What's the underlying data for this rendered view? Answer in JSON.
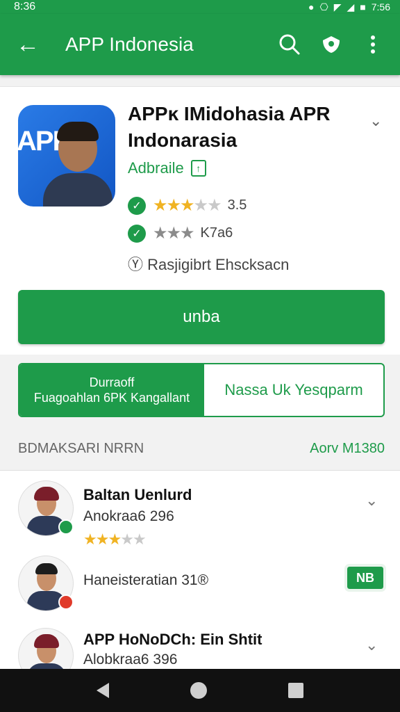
{
  "status_bar": {
    "time": "8:36",
    "clock_right": "7:56",
    "icons": [
      "notification-icon",
      "vibrate-icon",
      "wifi-icon",
      "signal-icon",
      "battery-icon"
    ]
  },
  "app_bar": {
    "title": "APP Indonesia",
    "icons": [
      "back-arrow-icon",
      "search-icon",
      "shield-icon",
      "more-vert-icon"
    ]
  },
  "app_detail": {
    "title": "APPĸ IMidohasia APR Indonarasia",
    "subtitle": "Adbraile",
    "rating_1": "3.5",
    "rating_1_stars": 3.5,
    "rating_2": "K7a6",
    "meta": "Rasjigibrt Ehscksacn",
    "install_label": "unba"
  },
  "tabs": {
    "active_line1": "Durraoff",
    "active_line2": "Fuagoahlan 6PK Kangallant",
    "inactive": "Nassa Uk Yesqparm"
  },
  "section": {
    "label": "BDMAKSARI NRRN",
    "right": "Aorv M1380"
  },
  "list": [
    {
      "title": "Baltan Uenlurd",
      "subtitle": "Anokraa6 296",
      "stars": 3.5,
      "action": "chevron",
      "badge": "green"
    },
    {
      "title": "",
      "subtitle": "Haneisteratian 31®",
      "action": "NB",
      "badge": "red"
    },
    {
      "title": "APP HoNoDCh: Ein Shtit",
      "subtitle": "Alobkraa6 396",
      "action": "chevron",
      "badge": "green"
    }
  ],
  "colors": {
    "brand_green": "#1e9b4a",
    "star_gold": "#f0b323",
    "nav_bar": "#111111"
  }
}
